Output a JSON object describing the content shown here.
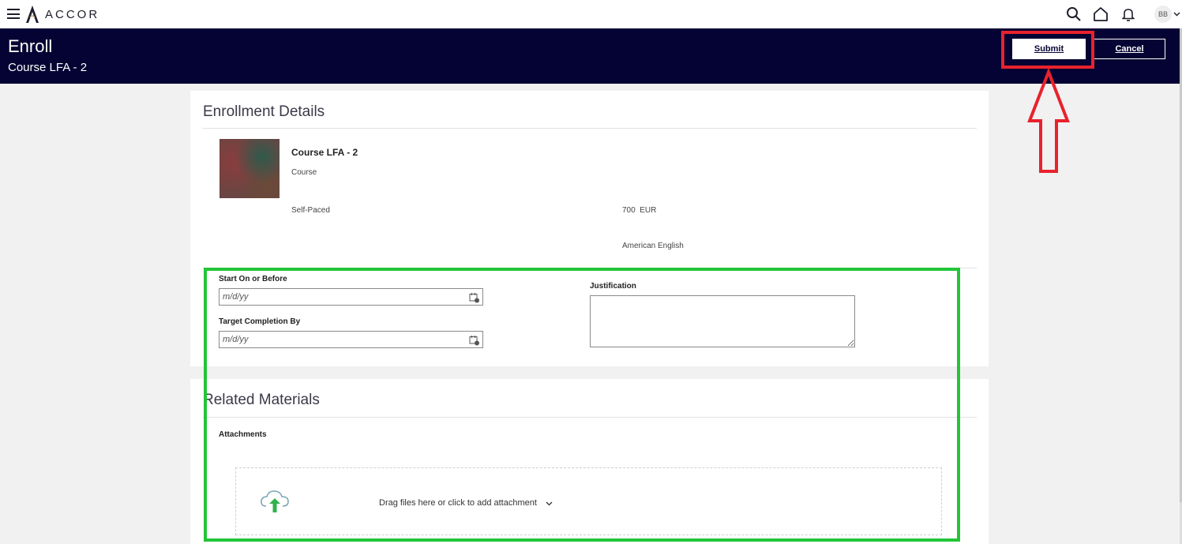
{
  "brand": {
    "name": "ACCOR"
  },
  "nav": {
    "icons": [
      "menu-icon",
      "search-icon",
      "home-icon",
      "bell-icon"
    ],
    "avatar_initials": "BB"
  },
  "header": {
    "title": "Enroll",
    "subtitle": "Course LFA - 2",
    "submit_label": "Submit",
    "cancel_label": "Cancel"
  },
  "enrollment": {
    "section_title": "Enrollment Details",
    "course_name": "Course LFA - 2",
    "course_type": "Course",
    "pace": "Self-Paced",
    "price": "700  EUR",
    "language": "American English"
  },
  "form": {
    "start_label": "Start On or Before",
    "start_placeholder": "m/d/yy",
    "target_label": "Target Completion By",
    "target_placeholder": "m/d/yy",
    "justification_label": "Justification",
    "justification_value": ""
  },
  "related": {
    "section_title": "Related Materials",
    "attachments_label": "Attachments",
    "drop_text": "Drag files here or click to add attachment"
  },
  "colors": {
    "header_bg": "#050333",
    "annotation_red": "#e8222d",
    "annotation_green": "#22c538"
  }
}
